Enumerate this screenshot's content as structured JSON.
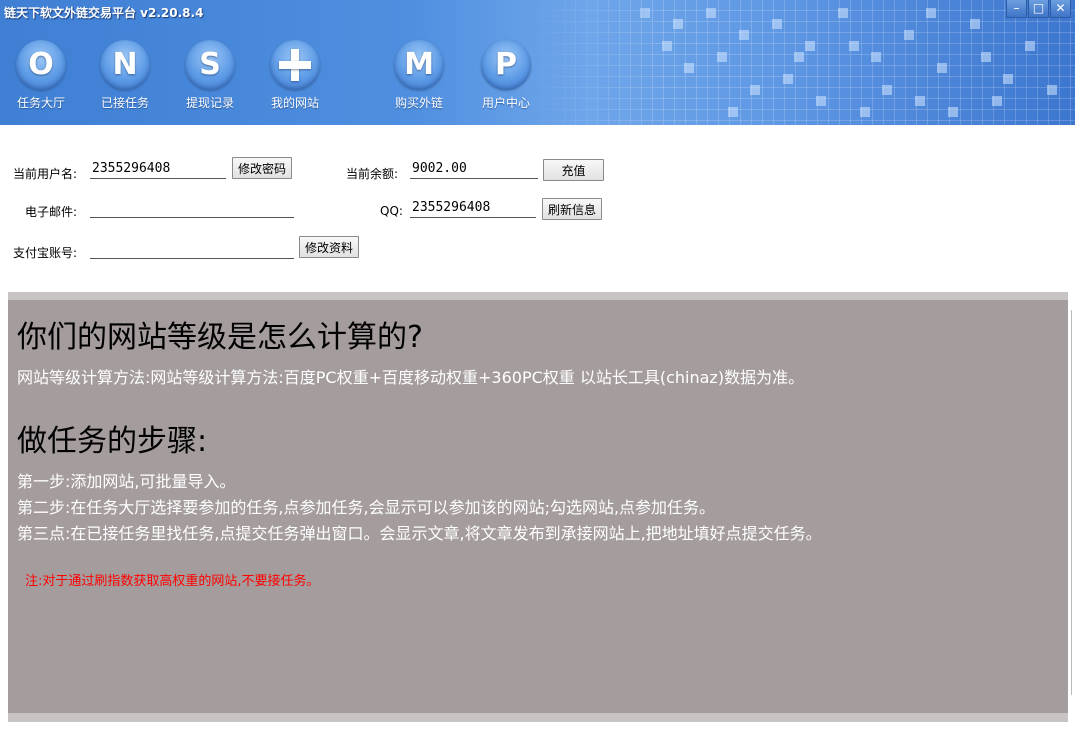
{
  "window": {
    "title": "链天下软文外链交易平台 v2.20.8.4",
    "minimize": "–",
    "maximize": "□",
    "close": "✕"
  },
  "nav": [
    {
      "glyph": "O",
      "label": "任务大厅"
    },
    {
      "glyph": "N",
      "label": "已接任务"
    },
    {
      "glyph": "S",
      "label": "提现记录"
    },
    {
      "glyph": "+",
      "label": "我的网站"
    },
    {
      "glyph": "M",
      "label": "购买外链"
    },
    {
      "glyph": "P",
      "label": "用户中心"
    }
  ],
  "form": {
    "username_label": "当前用户名:",
    "username_value": "2355296408",
    "change_password": "修改密码",
    "balance_label": "当前余额:",
    "balance_value": "9002.00",
    "recharge": "充值",
    "email_label": "电子邮件:",
    "email_value": "",
    "qq_label": "QQ:",
    "qq_value": "2355296408",
    "refresh": "刷新信息",
    "alipay_label": "支付宝账号:",
    "alipay_value": "",
    "edit_profile": "修改资料"
  },
  "content": {
    "heading1": "你们的网站等级是怎么计算的?",
    "para1": "网站等级计算方法:网站等级计算方法:百度PC权重+百度移动权重+360PC权重  以站长工具(chinaz)数据为准。",
    "heading2": "做任务的步骤:",
    "steps": [
      "第一步:添加网站,可批量导入。",
      "第二步:在任务大厅选择要参加的任务,点参加任务,会显示可以参加该的网站;勾选网站,点参加任务。",
      "第三点:在已接任务里找任务,点提交任务弹出窗口。会显示文章,将文章发布到承接网站上,把地址填好点提交任务。"
    ],
    "note": "注:对于通过刷指数获取高权重的网站,不要接任务。"
  },
  "colors": {
    "header": "#4f8fe0",
    "panel": "#a59d9d",
    "note": "#ff0000"
  }
}
